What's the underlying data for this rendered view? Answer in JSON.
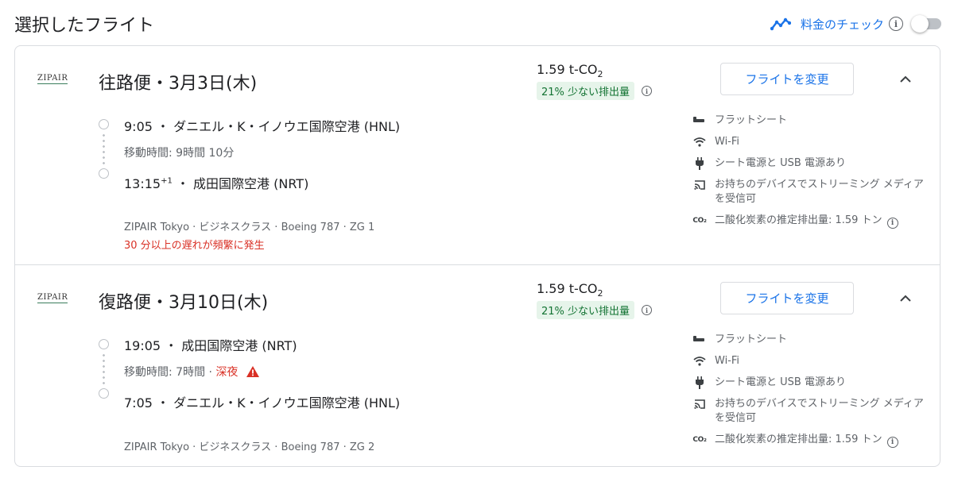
{
  "header": {
    "title": "選択したフライト",
    "price_tracking_label": "料金のチェック",
    "price_tracking_on": false,
    "accent_color": "#1a73e8"
  },
  "legs": [
    {
      "airline_logo": "ZIPAIR",
      "title": "往路便・3月3日(木)",
      "co2_value": "1.59 t-CO",
      "co2_sub": "2",
      "co2_badge": "21% 少ない排出量",
      "change_button": "フライトを変更",
      "departure_time": "9:05",
      "departure_sup": "",
      "departure_airport": "ダニエル・K・イノウエ国際空港 (HNL)",
      "duration": "移動時間: 9時間 10分",
      "duration_flag": "",
      "arrival_time": "13:15",
      "arrival_sup": "+1",
      "arrival_airport": "成田国際空港 (NRT)",
      "flight_info": "ZIPAIR Tokyo · ビジネスクラス · Boeing 787 · ZG 1",
      "delay_note": "30 分以上の遅れが頻繁に発生",
      "amenities": {
        "seat": "フラットシート",
        "wifi": "Wi-Fi",
        "power": "シート電源と USB 電源あり",
        "streaming": "お持ちのデバイスでストリーミング メディアを受信可",
        "co2": "二酸化炭素の推定排出量: 1.59 トン"
      }
    },
    {
      "airline_logo": "ZIPAIR",
      "title": "復路便・3月10日(木)",
      "co2_value": "1.59 t-CO",
      "co2_sub": "2",
      "co2_badge": "21% 少ない排出量",
      "change_button": "フライトを変更",
      "departure_time": "19:05",
      "departure_sup": "",
      "departure_airport": "成田国際空港 (NRT)",
      "duration": "移動時間: 7時間 · ",
      "duration_flag": "深夜",
      "arrival_time": "7:05",
      "arrival_sup": "",
      "arrival_airport": "ダニエル・K・イノウエ国際空港 (HNL)",
      "flight_info": "ZIPAIR Tokyo · ビジネスクラス · Boeing 787 · ZG 2",
      "delay_note": "",
      "amenities": {
        "seat": "フラットシート",
        "wifi": "Wi-Fi",
        "power": "シート電源と USB 電源あり",
        "streaming": "お持ちのデバイスでストリーミング メディアを受信可",
        "co2": "二酸化炭素の推定排出量: 1.59 トン"
      }
    }
  ],
  "icons": {
    "trend": "trending-line-icon",
    "info": "info-icon",
    "chevron": "chevron-up-icon",
    "seat": "flat-seat-icon",
    "wifi": "wifi-icon",
    "power": "power-plug-icon",
    "streaming": "cast-icon",
    "co2": "co2-icon",
    "warning": "warning-icon"
  },
  "colors": {
    "badge_bg": "#e6f4ea",
    "badge_text": "#137333",
    "warning": "#d93025"
  }
}
